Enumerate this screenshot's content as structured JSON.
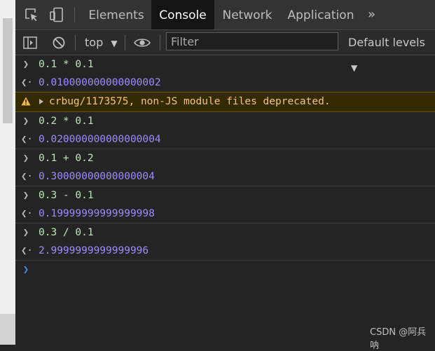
{
  "tabs": [
    "Elements",
    "Console",
    "Network",
    "Application"
  ],
  "active_tab": "Console",
  "toolbar": {
    "context": "top",
    "filter_placeholder": "Filter",
    "levels": "Default levels"
  },
  "console": {
    "entries": [
      {
        "kind": "input",
        "text": "0.1 * 0.1"
      },
      {
        "kind": "output",
        "text": "0.010000000000000002"
      },
      {
        "kind": "warning",
        "text": "crbug/1173575, non-JS module files deprecated."
      },
      {
        "kind": "input",
        "text": "0.2 * 0.1"
      },
      {
        "kind": "output",
        "text": "0.020000000000000004"
      },
      {
        "kind": "input",
        "text": "0.1 + 0.2"
      },
      {
        "kind": "output",
        "text": "0.30000000000000004"
      },
      {
        "kind": "input",
        "text": "0.3 - 0.1"
      },
      {
        "kind": "output",
        "text": "0.19999999999999998"
      },
      {
        "kind": "input",
        "text": "0.3 / 0.1"
      },
      {
        "kind": "output",
        "text": "2.9999999999999996"
      }
    ]
  },
  "watermark": "CSDN @阿兵呐",
  "icons": {
    "inspect": "inspect-element-icon",
    "device": "device-toolbar-icon",
    "more_tabs": "more-tabs-icon",
    "sidebar": "show-sidebar-icon",
    "clear": "clear-console-icon",
    "eye": "live-expression-icon"
  }
}
